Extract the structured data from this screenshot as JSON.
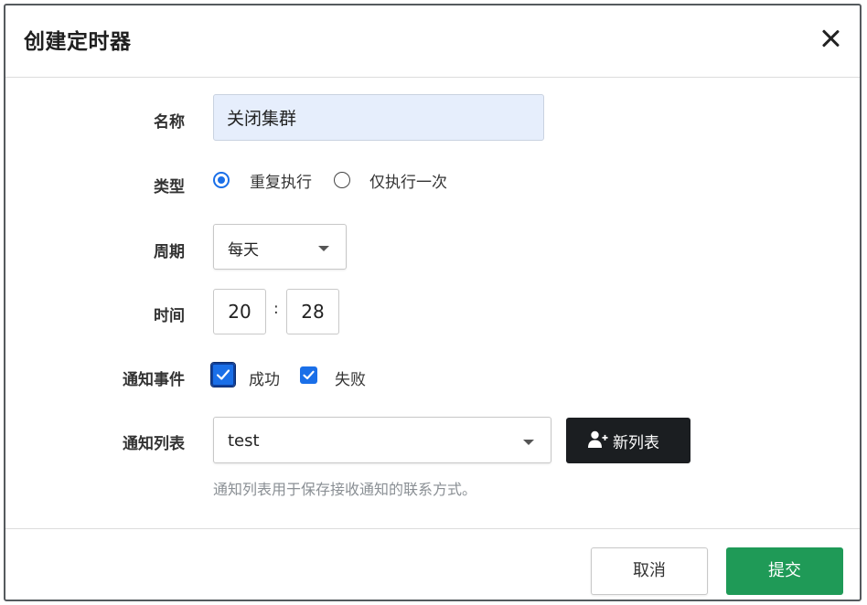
{
  "dialog": {
    "title": "创建定时器",
    "close_icon": "close-icon"
  },
  "form": {
    "name": {
      "label": "名称",
      "value": "关闭集群"
    },
    "type": {
      "label": "类型",
      "options": [
        {
          "label": "重复执行",
          "checked": true
        },
        {
          "label": "仅执行一次",
          "checked": false
        }
      ]
    },
    "period": {
      "label": "周期",
      "value": "每天"
    },
    "time": {
      "label": "时间",
      "hour": "20",
      "separator": ":",
      "minute": "28"
    },
    "events": {
      "label": "通知事件",
      "options": [
        {
          "label": "成功",
          "checked": true
        },
        {
          "label": "失败",
          "checked": true
        }
      ]
    },
    "notify_list": {
      "label": "通知列表",
      "value": "test",
      "new_button": "新列表",
      "hint": "通知列表用于保存接收通知的联系方式。"
    }
  },
  "footer": {
    "cancel": "取消",
    "submit": "提交"
  },
  "colors": {
    "accent": "#1a6fe8",
    "submit": "#1f9a57",
    "dark_button": "#1b1e21",
    "name_input_bg": "#e6eefc"
  }
}
